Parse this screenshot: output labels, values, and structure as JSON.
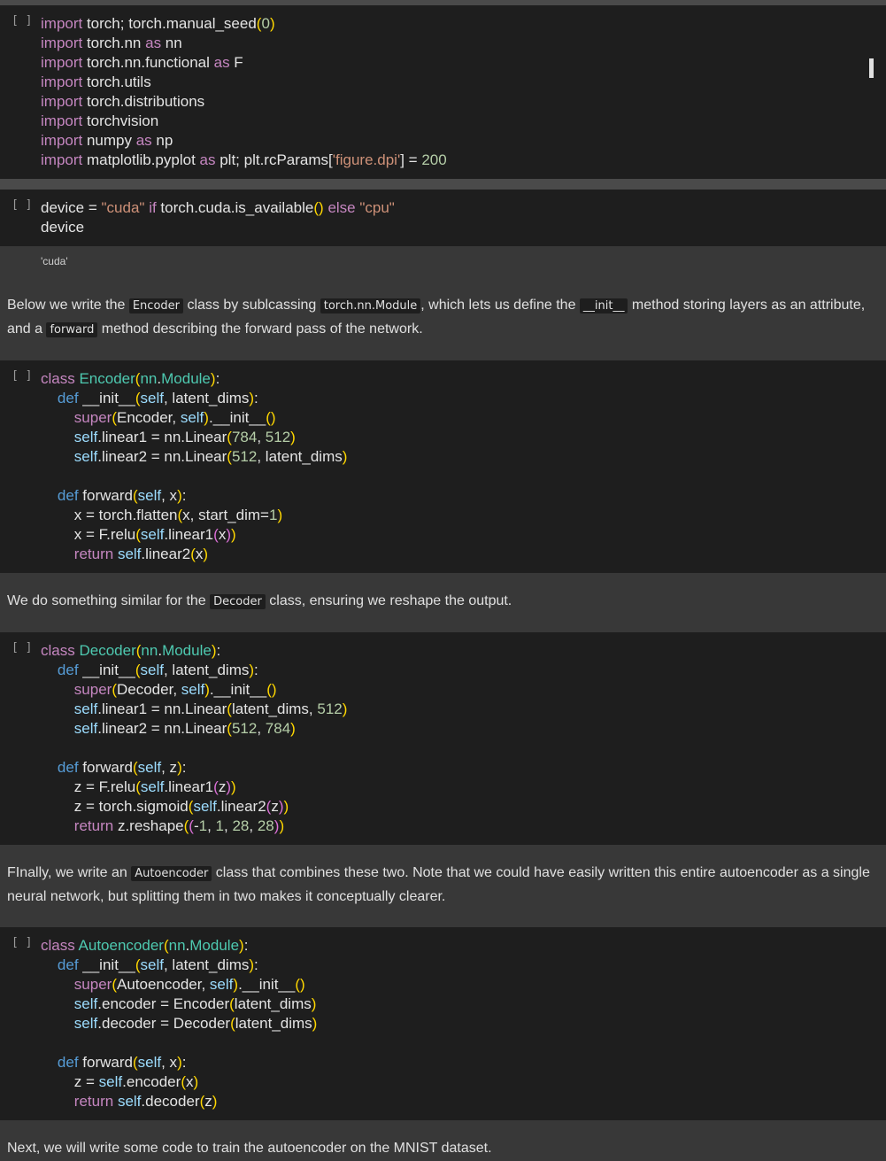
{
  "cells": {
    "cell1": {
      "bracket": "[ ]",
      "lines": [
        "import torch; torch.manual_seed(0)",
        "import torch.nn as nn",
        "import torch.nn.functional as F",
        "import torch.utils",
        "import torch.distributions",
        "import torchvision",
        "import numpy as np",
        "import matplotlib.pyplot as plt; plt.rcParams['figure.dpi'] = 200"
      ]
    },
    "cell2": {
      "bracket": "[ ]",
      "lines": [
        "device = \"cuda\" if torch.cuda.is_available() else \"cpu\"",
        "device"
      ],
      "output": "'cuda'"
    },
    "md1": {
      "text_1": "Below we write the ",
      "code_1": "Encoder",
      "text_2": " class by sublcassing ",
      "code_2": "torch.nn.Module",
      "text_3": ", which lets us define the ",
      "code_3": "__init__",
      "text_4": " method storing layers as an attribute, and a ",
      "code_4": "forward",
      "text_5": " method describing the forward pass of the network."
    },
    "cell3": {
      "bracket": "[ ]",
      "lines": [
        "class Encoder(nn.Module):",
        "    def __init__(self, latent_dims):",
        "        super(Encoder, self).__init__()",
        "        self.linear1 = nn.Linear(784, 512)",
        "        self.linear2 = nn.Linear(512, latent_dims)",
        "",
        "    def forward(self, x):",
        "        x = torch.flatten(x, start_dim=1)",
        "        x = F.relu(self.linear1(x))",
        "        return self.linear2(x)"
      ]
    },
    "md2": {
      "text_1": "We do something similar for the ",
      "code_1": "Decoder",
      "text_2": " class, ensuring we reshape the output."
    },
    "cell4": {
      "bracket": "[ ]",
      "lines": [
        "class Decoder(nn.Module):",
        "    def __init__(self, latent_dims):",
        "        super(Decoder, self).__init__()",
        "        self.linear1 = nn.Linear(latent_dims, 512)",
        "        self.linear2 = nn.Linear(512, 784)",
        "",
        "    def forward(self, z):",
        "        z = F.relu(self.linear1(z))",
        "        z = torch.sigmoid(self.linear2(z))",
        "        return z.reshape((-1, 1, 28, 28))"
      ]
    },
    "md3": {
      "text_1": "FInally, we write an ",
      "code_1": "Autoencoder",
      "text_2": " class that combines these two. Note that we could have easily written this entire autoencoder as a single neural network, but splitting them in two makes it conceptually clearer."
    },
    "cell5": {
      "bracket": "[ ]",
      "lines": [
        "class Autoencoder(nn.Module):",
        "    def __init__(self, latent_dims):",
        "        super(Autoencoder, self).__init__()",
        "        self.encoder = Encoder(latent_dims)",
        "        self.decoder = Decoder(latent_dims)",
        "",
        "    def forward(self, x):",
        "        z = self.encoder(x)",
        "        return self.decoder(z)"
      ]
    },
    "md4": {
      "text_1": "Next, we will write some code to train the autoencoder on the MNIST dataset."
    }
  },
  "colors": {
    "cell_bg": "#1e1e1e",
    "markdown_bg": "#383838",
    "keyword": "#c586c0",
    "class_name": "#4ec9b0",
    "string": "#ce9178",
    "number": "#b5cea8",
    "def": "#569cd6"
  }
}
